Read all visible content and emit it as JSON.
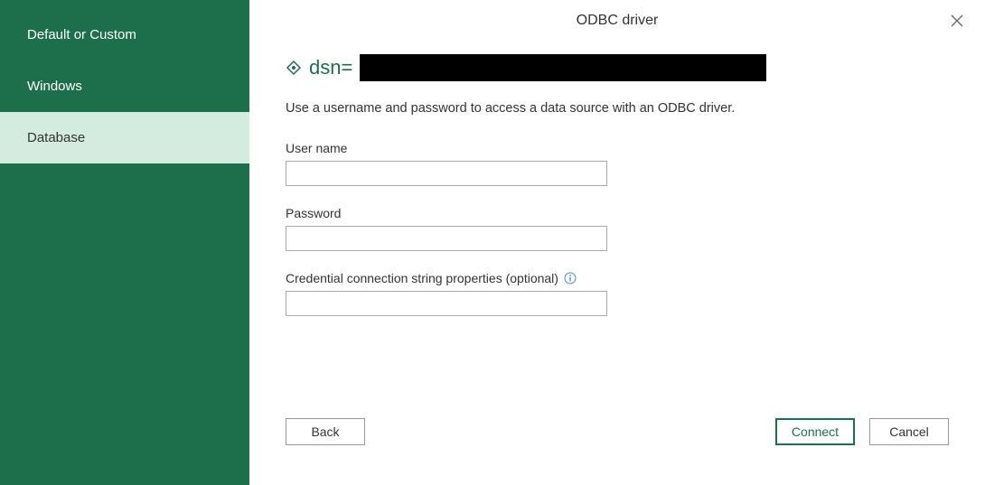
{
  "header": {
    "title": "ODBC driver"
  },
  "sidebar": {
    "items": [
      {
        "label": "Default or Custom"
      },
      {
        "label": "Windows"
      },
      {
        "label": "Database"
      }
    ]
  },
  "dsn": {
    "prefix": "dsn="
  },
  "instruction": "Use a username and password to access a data source with an ODBC driver.",
  "fields": {
    "username": {
      "label": "User name",
      "value": ""
    },
    "password": {
      "label": "Password",
      "value": ""
    },
    "connprops": {
      "label": "Credential connection string properties (optional)",
      "value": ""
    }
  },
  "buttons": {
    "back": "Back",
    "connect": "Connect",
    "cancel": "Cancel"
  },
  "colors": {
    "accent": "#1d6f4b",
    "sidebar_selected_bg": "#d4ecdf"
  }
}
